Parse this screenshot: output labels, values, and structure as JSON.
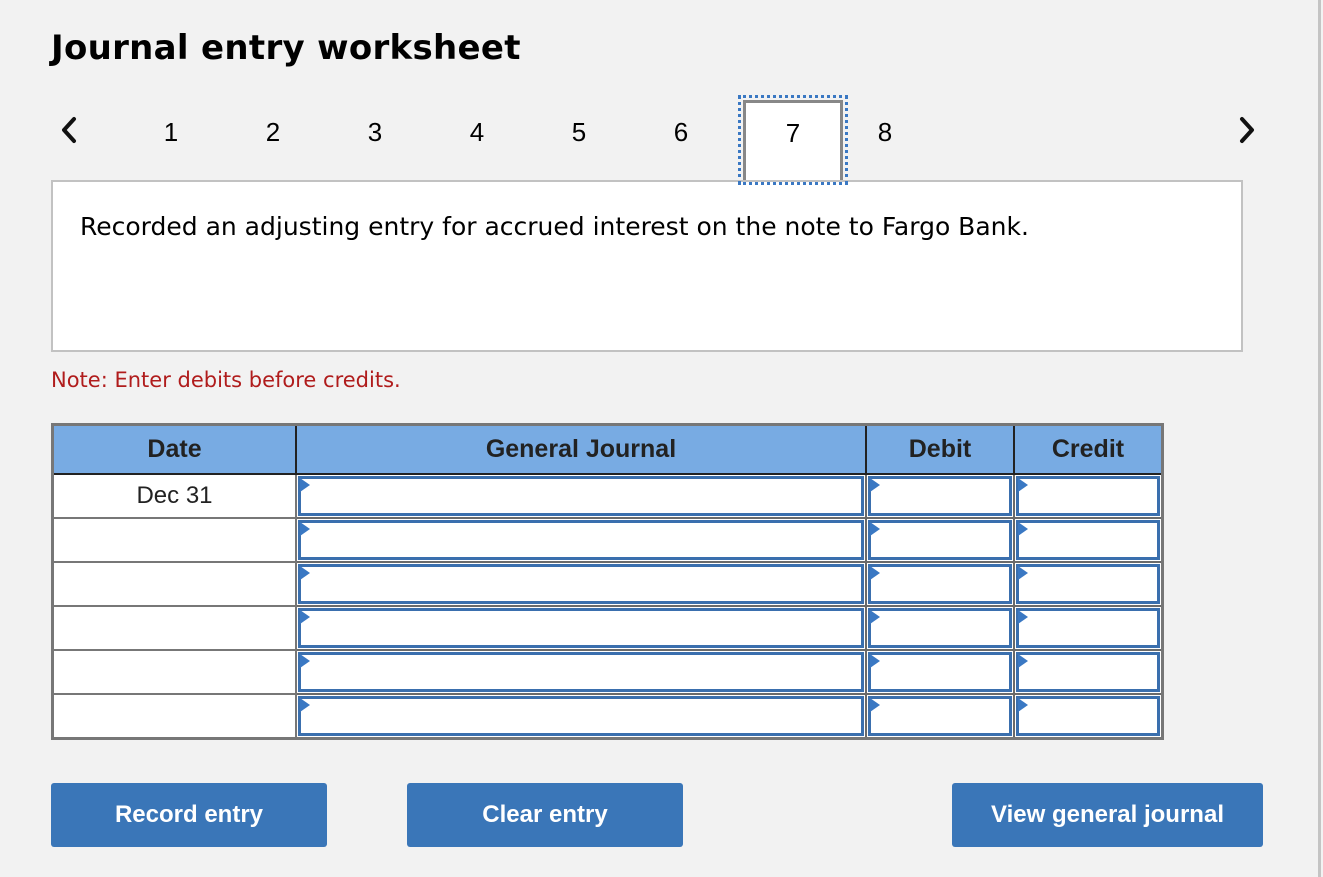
{
  "header": {
    "title": "Journal entry worksheet"
  },
  "pagination": {
    "prev_icon": "chevron-left-icon",
    "next_icon": "chevron-right-icon",
    "pages": [
      "1",
      "2",
      "3",
      "4",
      "5",
      "6",
      "7",
      "8"
    ],
    "active_page": "7"
  },
  "description": "Recorded an adjusting entry for accrued interest on the note to Fargo Bank.",
  "note": "Note: Enter debits before credits.",
  "table": {
    "headers": {
      "date": "Date",
      "general_journal": "General Journal",
      "debit": "Debit",
      "credit": "Credit"
    },
    "rows": [
      {
        "date": "Dec 31",
        "account": "",
        "debit": "",
        "credit": ""
      },
      {
        "date": "",
        "account": "",
        "debit": "",
        "credit": ""
      },
      {
        "date": "",
        "account": "",
        "debit": "",
        "credit": ""
      },
      {
        "date": "",
        "account": "",
        "debit": "",
        "credit": ""
      },
      {
        "date": "",
        "account": "",
        "debit": "",
        "credit": ""
      },
      {
        "date": "",
        "account": "",
        "debit": "",
        "credit": ""
      }
    ]
  },
  "buttons": {
    "record": "Record entry",
    "clear": "Clear entry",
    "view": "View general journal"
  },
  "colors": {
    "accent": "#3a76b8",
    "header_bg": "#78abe3",
    "note": "#b01c1c",
    "focus_outline": "#3a78c3"
  }
}
